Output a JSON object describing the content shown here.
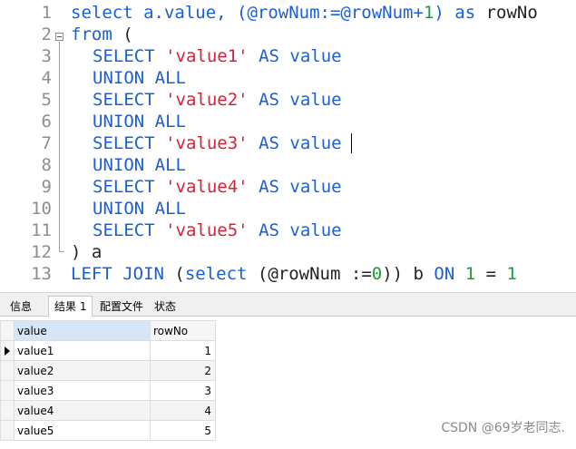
{
  "editor": {
    "line_numbers": [
      "1",
      "2",
      "3",
      "4",
      "5",
      "6",
      "7",
      "8",
      "9",
      "10",
      "11",
      "12",
      "13"
    ],
    "lines": [
      [
        {
          "t": "select a.value, (@rowNum:=@rowNum+",
          "c": "kw-mixed1"
        },
        {
          "t": "1",
          "c": "num"
        },
        {
          "t": ") ",
          "c": "kw-mixed2"
        },
        {
          "t": "as",
          "c": "kw"
        },
        {
          "t": " rowNo",
          "c": "plain"
        }
      ],
      [
        {
          "t": "from",
          "c": "kw"
        },
        {
          "t": " (",
          "c": "plain"
        }
      ],
      [
        {
          "t": "SELECT",
          "c": "kw"
        },
        {
          "t": " ",
          "c": "plain"
        },
        {
          "t": "'value1'",
          "c": "str"
        },
        {
          "t": " ",
          "c": "plain"
        },
        {
          "t": "AS",
          "c": "kw"
        },
        {
          "t": " value",
          "c": "kw"
        }
      ],
      [
        {
          "t": "UNION ALL",
          "c": "kw"
        }
      ],
      [
        {
          "t": "SELECT",
          "c": "kw"
        },
        {
          "t": " ",
          "c": "plain"
        },
        {
          "t": "'value2'",
          "c": "str"
        },
        {
          "t": " ",
          "c": "plain"
        },
        {
          "t": "AS",
          "c": "kw"
        },
        {
          "t": " value",
          "c": "kw"
        }
      ],
      [
        {
          "t": "UNION ALL",
          "c": "kw"
        }
      ],
      [
        {
          "t": "SELECT",
          "c": "kw"
        },
        {
          "t": " ",
          "c": "plain"
        },
        {
          "t": "'value3'",
          "c": "str"
        },
        {
          "t": " ",
          "c": "plain"
        },
        {
          "t": "AS",
          "c": "kw"
        },
        {
          "t": " value",
          "c": "kw"
        }
      ],
      [
        {
          "t": "UNION ALL",
          "c": "kw"
        }
      ],
      [
        {
          "t": "SELECT",
          "c": "kw"
        },
        {
          "t": " ",
          "c": "plain"
        },
        {
          "t": "'value4'",
          "c": "str"
        },
        {
          "t": " ",
          "c": "plain"
        },
        {
          "t": "AS",
          "c": "kw"
        },
        {
          "t": " value",
          "c": "kw"
        }
      ],
      [
        {
          "t": "UNION ALL",
          "c": "kw"
        }
      ],
      [
        {
          "t": "SELECT",
          "c": "kw"
        },
        {
          "t": " ",
          "c": "plain"
        },
        {
          "t": "'value5'",
          "c": "str"
        },
        {
          "t": " ",
          "c": "plain"
        },
        {
          "t": "AS",
          "c": "kw"
        },
        {
          "t": " value",
          "c": "kw"
        }
      ],
      [
        {
          "t": ") a",
          "c": "plain"
        }
      ],
      [
        {
          "t": "LEFT JOIN",
          "c": "kw"
        },
        {
          "t": " (",
          "c": "plain"
        },
        {
          "t": "select",
          "c": "kw"
        },
        {
          "t": " (@rowNum :=",
          "c": "plain"
        },
        {
          "t": "0",
          "c": "num"
        },
        {
          "t": ")) b ",
          "c": "plain"
        },
        {
          "t": "ON",
          "c": "kw"
        },
        {
          "t": " ",
          "c": "plain"
        },
        {
          "t": "1",
          "c": "num"
        },
        {
          "t": " = ",
          "c": "plain"
        },
        {
          "t": "1",
          "c": "num"
        }
      ]
    ]
  },
  "tabs": [
    {
      "label": "信息"
    },
    {
      "label": "结果 1",
      "active": true
    },
    {
      "label": "配置文件"
    },
    {
      "label": "状态"
    }
  ],
  "result": {
    "columns": [
      "value",
      "rowNo"
    ],
    "rows": [
      [
        "value1",
        "1"
      ],
      [
        "value2",
        "2"
      ],
      [
        "value3",
        "3"
      ],
      [
        "value4",
        "4"
      ],
      [
        "value5",
        "5"
      ]
    ]
  },
  "watermark": "CSDN @69岁老同志.",
  "colors": {
    "keyword": "#1a5fd9",
    "string": "#d6223a",
    "number": "#1a9e3a",
    "plain": "#222222"
  },
  "icons": {
    "current_row": "triangle-right-icon",
    "fold": "fold-collapse-icon"
  }
}
